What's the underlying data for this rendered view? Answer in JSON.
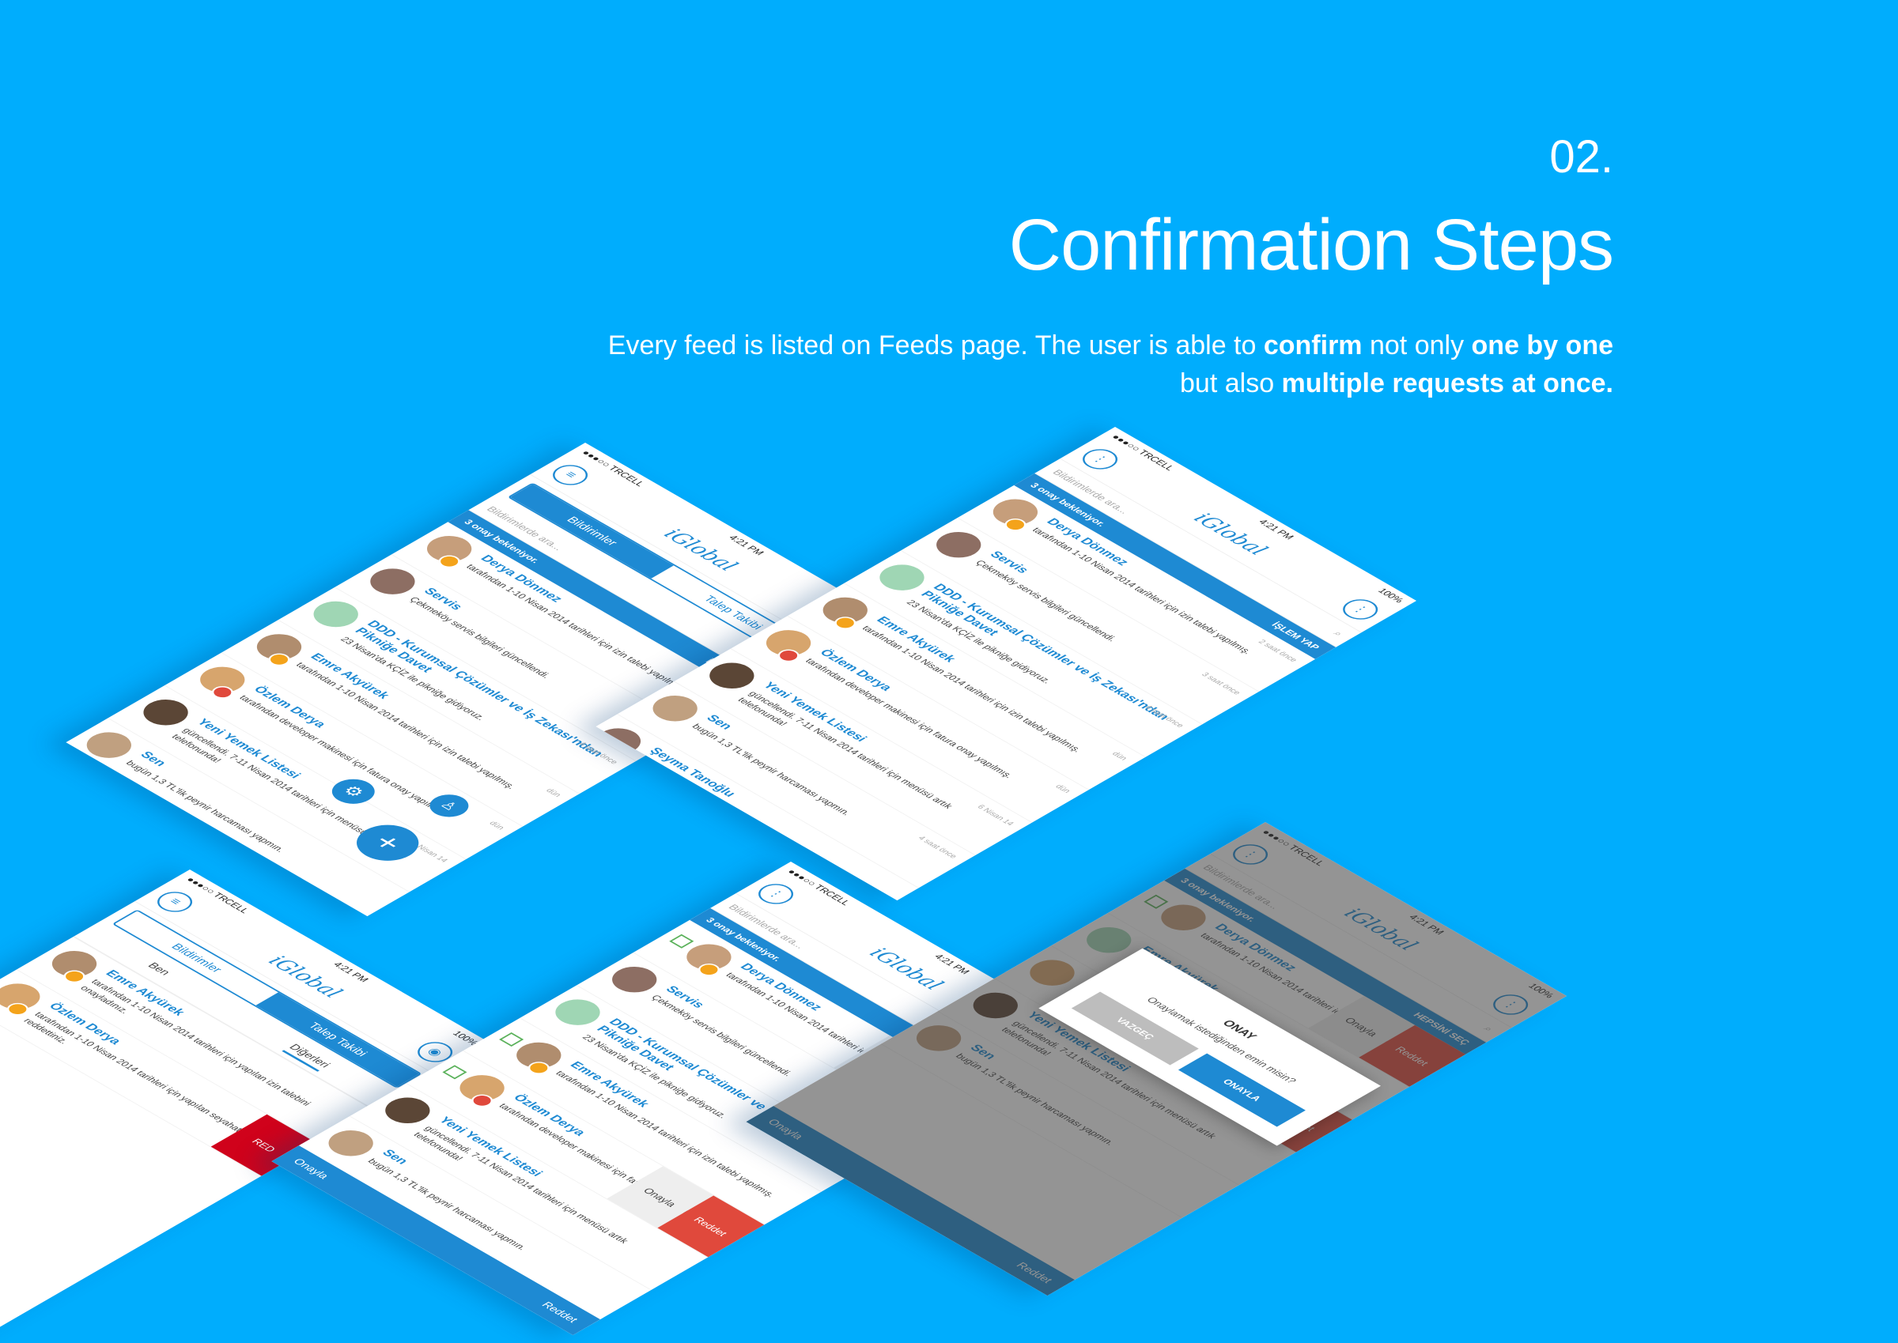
{
  "hero": {
    "number": "02.",
    "title": "Confirmation Steps",
    "desc_1": "Every feed is listed on Feeds page. The user is able to ",
    "desc_bold_1": "confirm",
    "desc_2": " not only ",
    "desc_bold_2": "one by one",
    "desc_3": " but also ",
    "desc_bold_3": "multiple requests at once."
  },
  "status": {
    "carrier": "●●●○○ TRCELL",
    "time": "4:21 PM",
    "battery": "100%"
  },
  "app": {
    "logo": "iGlobal",
    "tab_notifications": "Bildirimler",
    "tab_tracking": "Talep Takibi",
    "search_placeholder": "Bildirimlerde ara...",
    "pending": "3 onay bekleniyor.",
    "action": "İŞLEM YAP",
    "select_all": "HEPSİNİ SEÇ",
    "approve": "Onayla",
    "reject": "Reddet",
    "red_label": "RED",
    "sub_me": "Ben",
    "sub_others": "Diğerleri",
    "bottom_approve": "Onayla",
    "bottom_reject": "Reddet"
  },
  "feed": [
    {
      "name": "Derya Dönmez",
      "desc": "tarafından 1-10 Nisan 2014 tarihleri için izin talebi yapılmış.",
      "time": "2 saat önce"
    },
    {
      "name": "Servis",
      "desc": "Çekmeköy servis bilgileri güncellendi.",
      "time": "3 saat önce"
    },
    {
      "name": "DDD - Kurumsal Çözümler ve İş Zekası'ndan Pikniğe Davet",
      "desc": "23 Nisan'da KÇİZ ile pikniğe gidiyoruz.",
      "time": "4 saat önce"
    },
    {
      "name": "Emre Akyürek",
      "desc": "tarafından 1-10 Nisan 2014 tarihleri için izin talebi yapılmış.",
      "time": "dün"
    },
    {
      "name": "Özlem Derya",
      "desc": "tarafından developer makinesi için fatura onay yapılmış.",
      "time": "dün"
    },
    {
      "name": "Yeni Yemek Listesi",
      "desc": "güncellendi. 7-11 Nisan 2014 tarihleri için menüsü artık telefonunda!",
      "time": "6 Nisan 14"
    },
    {
      "name": "Sen",
      "desc": "bugün 1,3 TL'lik peynir harcaması yapmın.",
      "time": "4 saat önce"
    }
  ],
  "extra_name": "Şeyma Tanoğlu",
  "modal": {
    "title": "ONAY",
    "message": "Onaylamak istediğinden emin misin?",
    "cancel": "VAZGEÇ",
    "confirm": "ONAYLA"
  },
  "small_feed": [
    {
      "name": "Emre Akyürek",
      "desc": "tarafından 1-10 Nisan 2014 tarihleri için yapılan izin talebini onayladınız."
    },
    {
      "name": "Özlem Derya",
      "desc": "tarafından 1-10 Nisan 2014 tarihleri için yapılan seyahat talebini reddettiniz."
    }
  ],
  "icons": [
    "menu-icon",
    "profile-icon",
    "search-icon",
    "gear-icon",
    "plus-icon",
    "chevron-right-icon"
  ],
  "colors": {
    "background": "#00adfd",
    "primary": "#1e8ad3",
    "reject": "#e0493c",
    "red": "#d0021b"
  }
}
